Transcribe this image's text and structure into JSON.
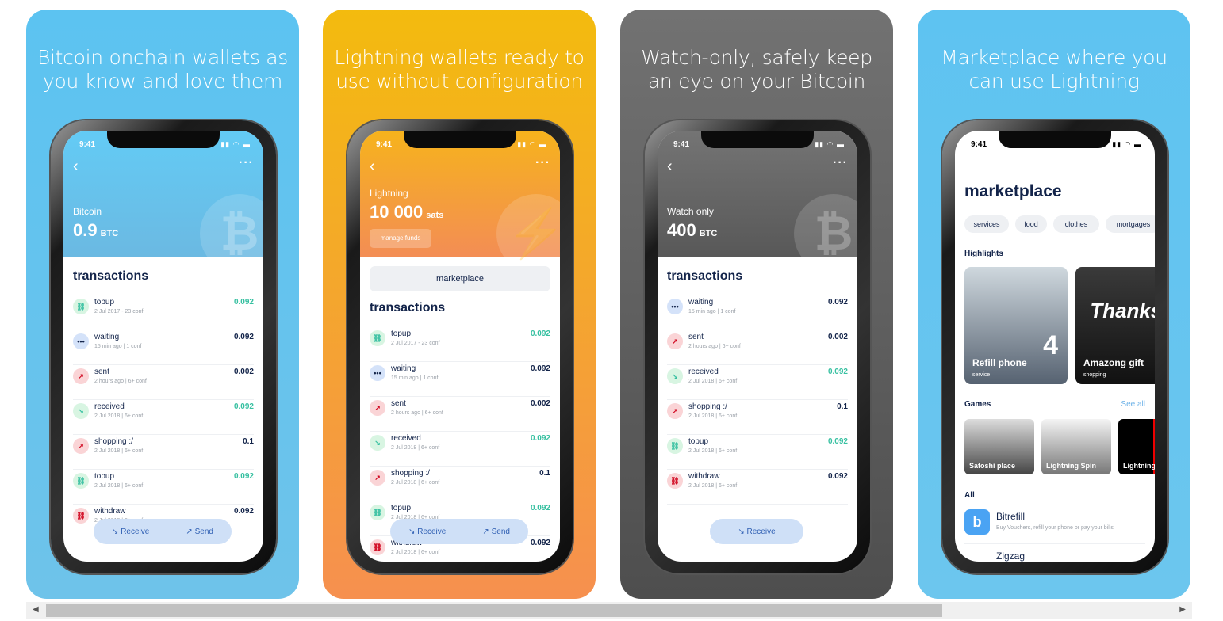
{
  "cards": [
    {
      "title": [
        "Bitcoin onchain wallets as",
        "you know and love them"
      ],
      "bg": [
        "#5cc3f1",
        "#6ec3ea"
      ],
      "hdr": [
        "#63cbf5",
        "#6bb9e2"
      ],
      "time": "9:41",
      "wallet_label": "Bitcoin",
      "amount": "0.9",
      "unit": "BTC",
      "coin_icon": "bitcoin-icon",
      "section": "transactions",
      "tx": [
        {
          "name": "topup",
          "sub": "2 Jul 2017 - 23 conf",
          "value": "0.092",
          "type": "topup"
        },
        {
          "name": "waiting",
          "sub": "15 min ago | 1 conf",
          "value": "0.092",
          "type": "waiting"
        },
        {
          "name": "sent",
          "sub": "2 hours ago | 6+ conf",
          "value": "0.002",
          "type": "sent"
        },
        {
          "name": "received",
          "sub": "2 Jul 2018 | 6+ conf",
          "value": "0.092",
          "type": "received"
        },
        {
          "name": "shopping :/",
          "sub": "2 Jul 2018 | 6+ conf",
          "value": "0.1",
          "type": "sent"
        },
        {
          "name": "topup",
          "sub": "2 Jul 2018 | 6+ conf",
          "value": "0.092",
          "type": "topup"
        },
        {
          "name": "withdraw",
          "sub": "2 Jul 2018 | 6+ conf",
          "value": "0.092",
          "type": "withdraw"
        }
      ],
      "buttons": [
        "Receive",
        "Send"
      ]
    },
    {
      "title": [
        "Lightning wallets ready to",
        "use without configuration"
      ],
      "bg": [
        "#f3bb0e",
        "#f6904f"
      ],
      "hdr": [
        "#f6b31c",
        "#f38d55"
      ],
      "time": "9:41",
      "wallet_label": "Lightning",
      "amount": "10 000",
      "unit": "sats",
      "coin_icon": "lightning-icon",
      "manage": "manage funds",
      "marketplace": "marketplace",
      "section": "transactions",
      "tx": [
        {
          "name": "topup",
          "sub": "2 Jul 2017 - 23 conf",
          "value": "0.092",
          "type": "topup"
        },
        {
          "name": "waiting",
          "sub": "15 min ago | 1 conf",
          "value": "0.092",
          "type": "waiting"
        },
        {
          "name": "sent",
          "sub": "2 hours ago | 6+ conf",
          "value": "0.002",
          "type": "sent"
        },
        {
          "name": "received",
          "sub": "2 Jul 2018 | 6+ conf",
          "value": "0.092",
          "type": "received"
        },
        {
          "name": "shopping :/",
          "sub": "2 Jul 2018 | 6+ conf",
          "value": "0.1",
          "type": "sent"
        },
        {
          "name": "topup",
          "sub": "2 Jul 2018 | 6+ conf",
          "value": "0.092",
          "type": "topup"
        },
        {
          "name": "withdraw",
          "sub": "2 Jul 2018 | 6+ conf",
          "value": "0.092",
          "type": "withdraw"
        }
      ],
      "buttons": [
        "Receive",
        "Send"
      ]
    },
    {
      "title": [
        "Watch-only, safely keep",
        "an eye on your Bitcoin"
      ],
      "bg": [
        "#727272",
        "#4e4e4e"
      ],
      "hdr": [
        "#747474",
        "#585858"
      ],
      "time": "9:41",
      "wallet_label": "Watch only",
      "amount": "400",
      "unit": "BTC",
      "coin_icon": "bitcoin-icon",
      "section": "transactions",
      "tx": [
        {
          "name": "waiting",
          "sub": "15 min ago | 1 conf",
          "value": "0.092",
          "type": "waiting"
        },
        {
          "name": "sent",
          "sub": "2 hours ago | 6+ conf",
          "value": "0.002",
          "type": "sent"
        },
        {
          "name": "received",
          "sub": "2 Jul 2018 | 6+ conf",
          "value": "0.092",
          "type": "received"
        },
        {
          "name": "shopping :/",
          "sub": "2 Jul 2018 | 6+ conf",
          "value": "0.1",
          "type": "sent"
        },
        {
          "name": "topup",
          "sub": "2 Jul 2018 | 6+ conf",
          "value": "0.092",
          "type": "topup"
        },
        {
          "name": "withdraw",
          "sub": "2 Jul 2018 | 6+ conf",
          "value": "0.092",
          "type": "withdraw"
        }
      ],
      "buttons": [
        "Receive"
      ]
    },
    {
      "title": [
        "Marketplace where you",
        "can use Lightning"
      ],
      "bg": [
        "#5ec3f1",
        "#6cc6ee"
      ],
      "time": "9:41",
      "heading": "marketplace",
      "chips": [
        "services",
        "food",
        "clothes",
        "mortgages"
      ],
      "highlights_label": "Highlights",
      "highlights": [
        {
          "title": "Refill phone",
          "sub": "service",
          "badge": "4"
        },
        {
          "title": "Amazong gift",
          "sub": "shopping",
          "badge": "Thanks!"
        }
      ],
      "games_label": "Games",
      "see_all": "See all",
      "games": [
        "Satoshi place",
        "Lightning Spin",
        "Lightning"
      ],
      "all_label": "All",
      "apps": [
        {
          "name": "Bitrefill",
          "desc": "Buy Vouchers, refill your phone or pay your bills"
        },
        {
          "name": "Zigzag"
        }
      ]
    }
  ],
  "colors": {
    "green": "#37c0a1",
    "navy": "#13244a",
    "button": "#cfe0f7"
  }
}
